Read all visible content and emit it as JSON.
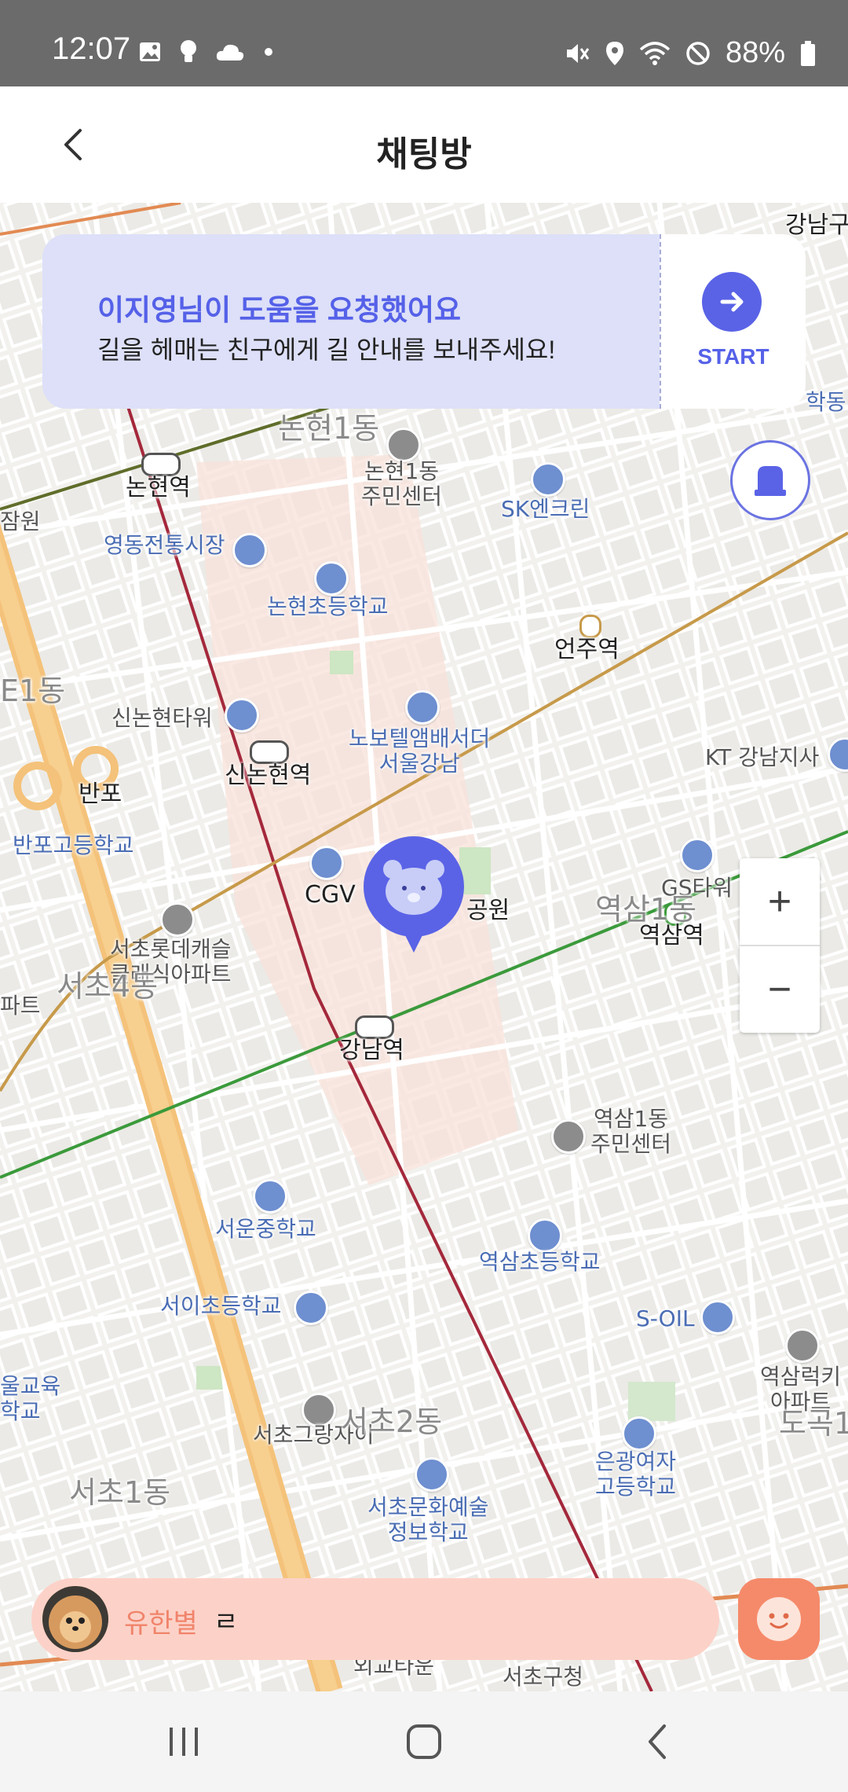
{
  "status_bar": {
    "time": "12:07",
    "battery": "88%",
    "left_icons": [
      "image-icon",
      "bulb-icon",
      "cloud-icon",
      "dot-icon"
    ],
    "right_icons": [
      "mute-icon",
      "location-icon",
      "wifi-icon",
      "dnd-icon",
      "battery-icon"
    ]
  },
  "header": {
    "title": "채팅방"
  },
  "banner": {
    "title": "이지영님이 도움을 요청했어요",
    "subtitle": "길을 헤매는 친구에게 길 안내를 보내주세요!",
    "start_label": "START"
  },
  "map": {
    "labels": {
      "gangnamgu": "강남구",
      "nonhyeon1dong": "논현1동",
      "nonhyeon_station": "논현역",
      "jamwon": "잠원",
      "nonhyeon1dong_center": "논현1동\n주민센터",
      "sk_enclean": "SK엔크린",
      "hakdong": "학동",
      "yeongdong_market": "영동전통시장",
      "nonhyeon_elementary": "논현초등학교",
      "eonju_station": "언주역",
      "dong1": "E1동",
      "sinnonhyeon_tower": "신논현타워",
      "novotel": "노보텔앰배서더\n서울강남",
      "kt_gangnam": "KT 강남지사",
      "banpo_ic": "반포",
      "sinnonhyeon_station": "신논현역",
      "banpo_high": "반포고등학교",
      "cgv": "CGV",
      "park": "공원",
      "gs_tower": "GS타워",
      "yeoksam_station": "역삼역",
      "yeoksam1dong": "역삼1동",
      "seocho_lotte": "서초롯데캐슬\n클래식아파트",
      "seocho4dong": "서초4동",
      "apt": "파트",
      "gangnam_station": "강남역",
      "yeoksam1dong_center": "역삼1동\n주민센터",
      "seoun_middle": "서운중학교",
      "yeoksam_elementary": "역삼초등학교",
      "seoi_elementary": "서이초등학교",
      "soil": "S-OIL",
      "education": "울교육\n학교",
      "yeoksam_lucky": "역삼럭키\n아파트",
      "dogok": "도곡1",
      "seocho_grang": "서초그랑자이",
      "seocho2dong": "서초2동",
      "eungwang_girls": "은광여자\n고등학교",
      "seocho1dong": "서초1동",
      "seocho_arts": "서초문화예술\n정보학교",
      "seocho_gu_office": "서초구청",
      "bottom_label": "외교타운"
    }
  },
  "zoom": {
    "plus": "+",
    "minus": "−"
  },
  "chat": {
    "name": "유한별",
    "message": "ㄹ"
  },
  "colors": {
    "accent": "#5561e8",
    "banner_bg": "#dde0f8",
    "chat_bg": "#fcd2c8",
    "chat_name": "#f0846b",
    "face_btn": "#f58a6a"
  }
}
